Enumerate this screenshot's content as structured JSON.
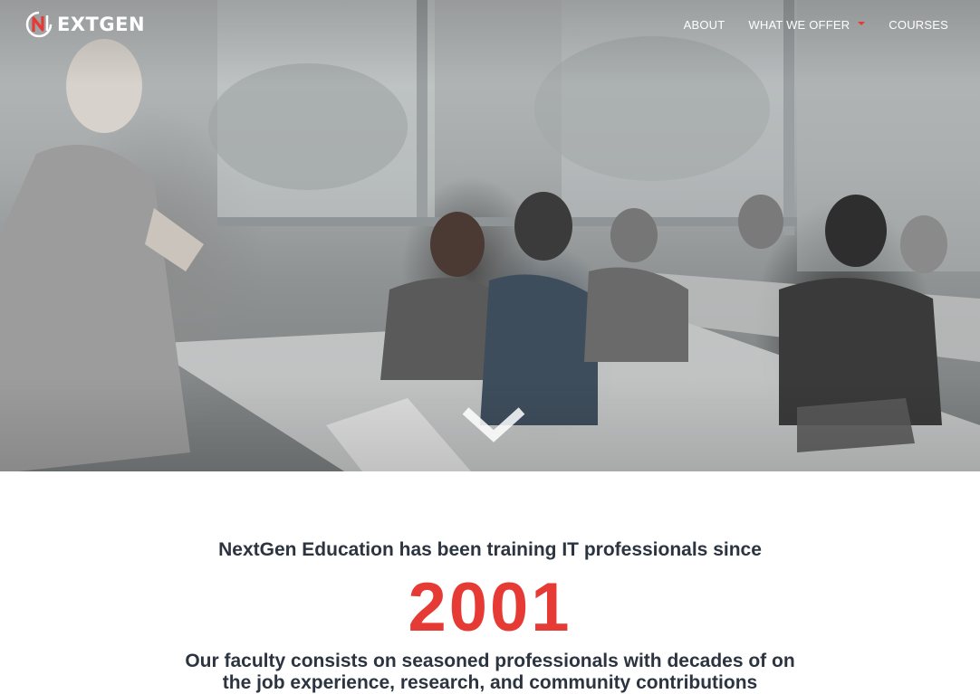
{
  "brand": {
    "logo_text": "EXTGEN",
    "logo_alt": "NextGen"
  },
  "nav": {
    "items": [
      {
        "label": "ABOUT"
      },
      {
        "label": "WHAT WE OFFER",
        "has_dropdown": true
      },
      {
        "label": "COURSES"
      }
    ]
  },
  "hero": {
    "image": "classroom-photo",
    "scroll_icon": "chevron-down-icon"
  },
  "intro": {
    "tagline": "NextGen Education has been training IT professionals since",
    "year": "2001",
    "faculty": "Our faculty consists on seasoned professionals with decades of on the job experience, research, and community contributions"
  },
  "colors": {
    "accent": "#e63a35",
    "heading": "#2c3440",
    "nav_text": "#ffffff"
  }
}
